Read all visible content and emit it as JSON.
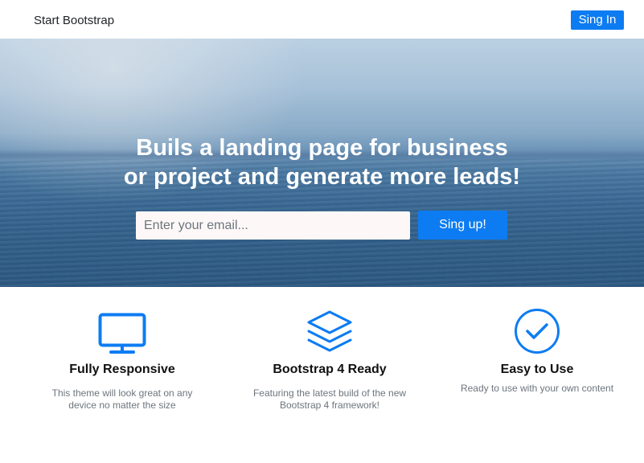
{
  "navbar": {
    "brand": "Start Bootstrap",
    "signin_label": "Sing In"
  },
  "hero": {
    "title_line1": "Buils a landing page for business",
    "title_line2": "or project and generate more leads!",
    "email_placeholder": "Enter your email...",
    "signup_label": "Sing up!"
  },
  "features": [
    {
      "icon": "monitor-icon",
      "title": "Fully Responsive",
      "description": "This theme will look great on any device no matter the size"
    },
    {
      "icon": "layers-icon",
      "title": "Bootstrap 4 Ready",
      "description": "Featuring the latest build of the new Bootstrap 4 framework!"
    },
    {
      "icon": "check-circle-icon",
      "title": "Easy to Use",
      "description": "Ready to use with your own content"
    }
  ],
  "colors": {
    "accent": "#0d7cf2",
    "hero_text": "#ffffff",
    "muted_text": "#6c757d"
  }
}
